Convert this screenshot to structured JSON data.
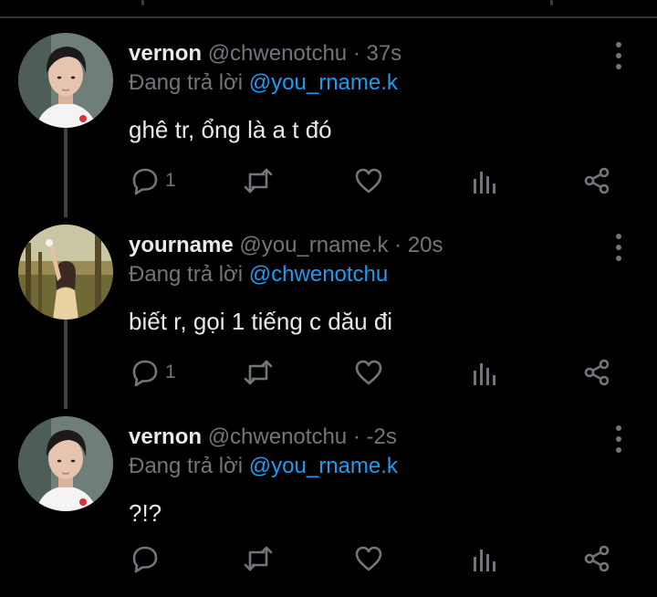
{
  "tweets": [
    {
      "name": "vernon",
      "handle": "@chwenotchu",
      "dot": "·",
      "time": "37s",
      "reply_prefix": "Đang trả lời",
      "reply_to": "@you_rname.k",
      "text": "ghê tr, ổng là a t đó",
      "reply_count": "1",
      "avatar_icon": "boy-avatar"
    },
    {
      "name": "yourname",
      "handle": "@you_rname.k",
      "dot": "·",
      "time": "20s",
      "reply_prefix": "Đang trả lời",
      "reply_to": "@chwenotchu",
      "text": "biết r, gọi 1 tiếng c dău đi",
      "reply_count": "1",
      "avatar_icon": "girl-avatar"
    },
    {
      "name": "vernon",
      "handle": "@chwenotchu",
      "dot": "·",
      "time": "-2s",
      "reply_prefix": "Đang trả lời",
      "reply_to": "@you_rname.k",
      "text": "?!?",
      "reply_count": "",
      "avatar_icon": "boy-avatar"
    }
  ],
  "colors": {
    "background": "#000000",
    "primary_text": "#e7e9ea",
    "secondary_text": "#71767b",
    "accent": "#1d9bf0",
    "thread_line": "#3e4144",
    "divider": "#2f3336"
  }
}
